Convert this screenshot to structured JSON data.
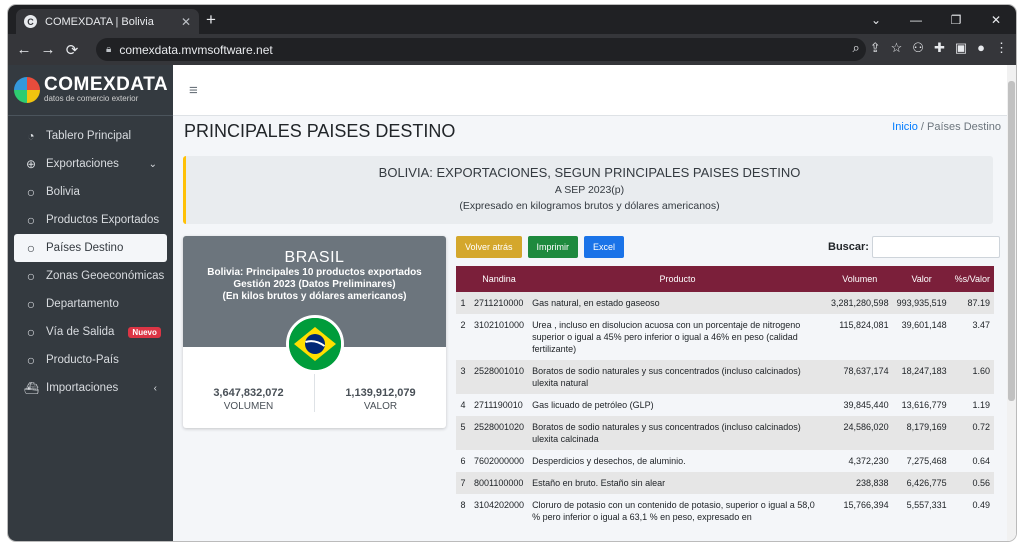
{
  "browser": {
    "tab_title": "COMEXDATA | Bolivia",
    "tab_favicon": "C",
    "url": "comexdata.mvmsoftware.net"
  },
  "brand": {
    "name": "COMEXDATA",
    "tagline": "datos de comercio exterior"
  },
  "sidebar": {
    "items": [
      {
        "label": "Tablero Principal",
        "icon": "dashboard-icon"
      },
      {
        "label": "Exportaciones",
        "icon": "globe-icon"
      },
      {
        "label": "Bolivia",
        "icon": "circle-icon"
      },
      {
        "label": "Productos Exportados",
        "icon": "circle-icon"
      },
      {
        "label": "Países Destino",
        "icon": "circle-icon"
      },
      {
        "label": "Zonas Geoeconómicas",
        "icon": "circle-icon"
      },
      {
        "label": "Departamento",
        "icon": "circle-icon"
      },
      {
        "label": "Vía de Salida",
        "icon": "circle-icon",
        "badge": "Nuevo"
      },
      {
        "label": "Producto-País",
        "icon": "circle-icon"
      },
      {
        "label": "Importaciones",
        "icon": "ship-icon"
      }
    ]
  },
  "page": {
    "title": "PRINCIPALES PAISES DESTINO",
    "breadcrumb_home": "Inicio",
    "breadcrumb_sep": "/",
    "breadcrumb_current": "Países Destino"
  },
  "callout": {
    "line1": "BOLIVIA: EXPORTACIONES, SEGUN PRINCIPALES PAISES DESTINO",
    "line2": "A SEP 2023(p)",
    "line3": "(Expresado en kilogramos brutos y dólares americanos)"
  },
  "country_card": {
    "country": "BRASIL",
    "sub1": "Bolivia: Principales 10 productos exportados",
    "sub2": "Gestión 2023 (Datos Preliminares)",
    "sub3": "(En kilos brutos y dólares americanos)",
    "volume_value": "3,647,832,072",
    "volume_label": "VOLUMEN",
    "value_value": "1,139,912,079",
    "value_label": "VALOR"
  },
  "buttons": {
    "back": "Volver atrás",
    "print": "Imprimir",
    "excel": "Excel"
  },
  "search": {
    "label": "Buscar:"
  },
  "table": {
    "headers": [
      "",
      "Nandina",
      "Producto",
      "Volumen",
      "Valor",
      "%s/Valor"
    ],
    "rows": [
      [
        "1",
        "2711210000",
        "Gas natural, en estado gaseoso",
        "3,281,280,598",
        "993,935,519",
        "87.19"
      ],
      [
        "2",
        "3102101000",
        "Urea , incluso en disolucion acuosa con un porcentaje de nitrogeno superior o igual a 45% pero inferior o igual a 46% en peso (calidad fertilizante)",
        "115,824,081",
        "39,601,148",
        "3.47"
      ],
      [
        "3",
        "2528001010",
        "Boratos de sodio naturales y sus concentrados (incluso calcinados) ulexita natural",
        "78,637,174",
        "18,247,183",
        "1.60"
      ],
      [
        "4",
        "2711190010",
        "Gas licuado de petróleo (GLP)",
        "39,845,440",
        "13,616,779",
        "1.19"
      ],
      [
        "5",
        "2528001020",
        "Boratos de sodio naturales y sus concentrados (incluso calcinados) ulexita calcinada",
        "24,586,020",
        "8,179,169",
        "0.72"
      ],
      [
        "6",
        "7602000000",
        "Desperdicios y desechos, de aluminio.",
        "4,372,230",
        "7,275,468",
        "0.64"
      ],
      [
        "7",
        "8001100000",
        "Estaño en bruto. Estaño sin alear",
        "238,838",
        "6,426,775",
        "0.56"
      ],
      [
        "8",
        "3104202000",
        "Cloruro de potasio con un contenido de potasio, superior o igual a 58,0 % pero inferior o igual a 63,1 % en peso, expresado en",
        "15,766,394",
        "5,557,331",
        "0.49"
      ]
    ]
  }
}
